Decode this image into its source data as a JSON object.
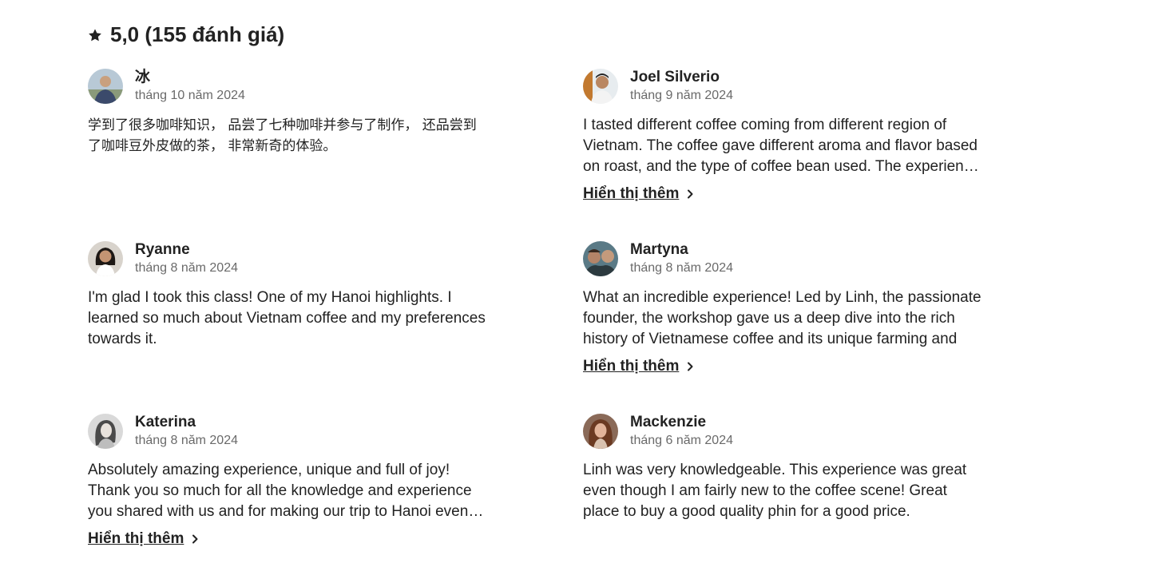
{
  "rating": {
    "icon": "star-icon",
    "text": "5,0 (155 đánh giá)"
  },
  "show_more_label": "Hiển thị thêm",
  "reviews": [
    {
      "name": "冰",
      "date": "tháng 10 năm 2024",
      "text": "学到了很多咖啡知识， 品尝了七种咖啡并参与了制作， 还品尝到了咖啡豆外皮做的茶， 非常新奇的体验。",
      "has_more": false
    },
    {
      "name": "Joel Silverio",
      "date": "tháng 9 năm 2024",
      "text": "I tasted different coffee coming from different region of Vietnam. The coffee gave different aroma and flavor based on roast, and the type of coffee bean used. The experience also",
      "has_more": true
    },
    {
      "name": "Ryanne",
      "date": "tháng 8 năm 2024",
      "text": "I'm glad I took this class! One of my Hanoi highlights. I learned so much about Vietnam coffee and my preferences towards it.",
      "has_more": false
    },
    {
      "name": "Martyna",
      "date": "tháng 8 năm 2024",
      "text": "What an incredible experience! Led by Linh, the passionate founder, the workshop gave us a deep dive into the rich history of Vietnamese coffee and its unique farming and",
      "has_more": true
    },
    {
      "name": "Katerina",
      "date": "tháng 8 năm 2024",
      "text": "Absolutely amazing experience, unique and full of joy! Thank you so much for all the knowledge and experience you shared with us and for making our trip to Hanoi even more special 🖤",
      "has_more": true
    },
    {
      "name": "Mackenzie",
      "date": "tháng 6 năm 2024",
      "text": "Linh was very knowledgeable. This experience was great even though I am fairly new to the coffee scene! Great place to buy a good quality phin for a good price.",
      "has_more": false
    }
  ]
}
